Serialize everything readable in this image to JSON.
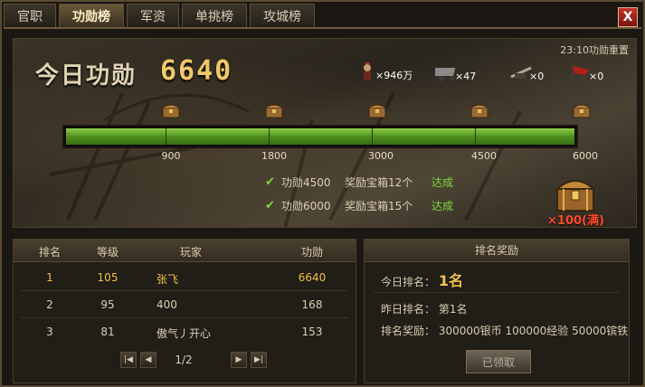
{
  "tabs": [
    {
      "label": "官职",
      "active": false
    },
    {
      "label": "功勋榜",
      "active": true
    },
    {
      "label": "军资",
      "active": false
    },
    {
      "label": "单挑榜",
      "active": false
    },
    {
      "label": "攻城榜",
      "active": false
    }
  ],
  "close_label": "X",
  "header": {
    "today_label": "今日功勋",
    "today_value": "6640",
    "reset_text": "23:10功勋重置"
  },
  "resources": [
    {
      "icon": "soldier-icon",
      "value": "×946万"
    },
    {
      "icon": "supply-cart-icon",
      "value": "×47"
    },
    {
      "icon": "ballista-icon",
      "value": "×0"
    },
    {
      "icon": "red-banner-icon",
      "value": "×0"
    }
  ],
  "progress": {
    "current": 6640,
    "max": 6000,
    "ticks": [
      "900",
      "1800",
      "3000",
      "4500",
      "6000"
    ],
    "fraction": 1.0
  },
  "rewards": [
    {
      "requirement": "功勋4500",
      "box": "奖励宝箱12个",
      "status": "达成"
    },
    {
      "requirement": "功勋6000",
      "box": "奖励宝箱15个",
      "status": "达成"
    }
  ],
  "chest_total": "×100(满)",
  "ranking": {
    "headers": [
      "排名",
      "等级",
      "玩家",
      "功勋"
    ],
    "rows": [
      {
        "rank": "1",
        "level": "105",
        "player": "张飞",
        "merit": "6640"
      },
      {
        "rank": "2",
        "level": "95",
        "player": "400",
        "merit": "168"
      },
      {
        "rank": "3",
        "level": "81",
        "player": "傲气丿开心",
        "merit": "153"
      }
    ],
    "page": "1/2"
  },
  "rank_reward": {
    "title": "排名奖励",
    "today_label": "今日排名：",
    "today_value": "1名",
    "yesterday_label": "昨日排名：",
    "yesterday_value": "第1名",
    "reward_label": "排名奖励：",
    "reward_value": "300000银币 100000经验 50000镔铁",
    "button": "已领取"
  },
  "colors": {
    "accent_gold": "#f0c86a",
    "progress_green": "#6db234",
    "achieved_green": "#7bdc3a",
    "chest_count_red": "#ff4a2a"
  }
}
